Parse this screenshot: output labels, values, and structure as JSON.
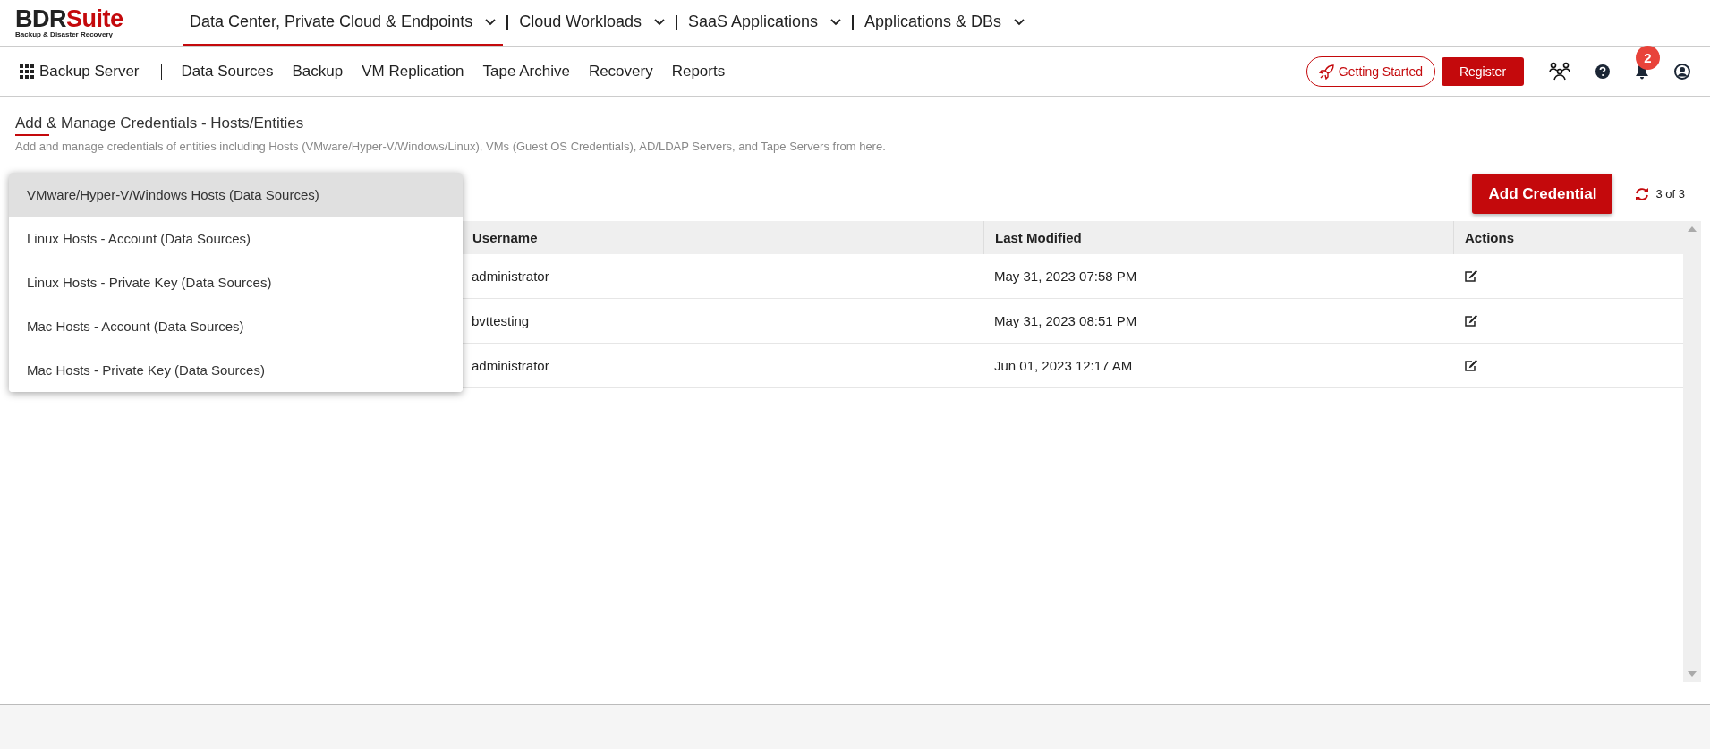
{
  "logo": {
    "brand": "BDR",
    "brand_accent": "Suite",
    "tagline": "Backup & Disaster Recovery"
  },
  "top_tabs": [
    {
      "label": "Data Center, Private Cloud & Endpoints",
      "selected": true
    },
    {
      "label": "Cloud Workloads",
      "selected": false
    },
    {
      "label": "SaaS Applications",
      "selected": false
    },
    {
      "label": "Applications & DBs",
      "selected": false
    }
  ],
  "module": {
    "label": "Backup Server"
  },
  "menu": [
    "Data Sources",
    "Backup",
    "VM Replication",
    "Tape Archive",
    "Recovery",
    "Reports"
  ],
  "getting_started": "Getting Started",
  "register": "Register",
  "notifications": {
    "count": "2"
  },
  "page": {
    "title": "Add & Manage Credentials - Hosts/Entities",
    "description": "Add and manage credentials of entities including Hosts (VMware/Hyper-V/Windows/Linux), VMs (Guest OS Credentials), AD/LDAP Servers, and Tape Servers from here."
  },
  "add_button": "Add Credential",
  "count": "3 of 3",
  "table": {
    "columns": [
      "Username",
      "Last Modified",
      "Actions"
    ],
    "rows": [
      {
        "username": "administrator",
        "last_modified": "May 31, 2023 07:58 PM"
      },
      {
        "username": "bvttesting",
        "last_modified": "May 31, 2023 08:51 PM"
      },
      {
        "username": "administrator",
        "last_modified": "Jun 01, 2023 12:17 AM"
      }
    ]
  },
  "dropdown": {
    "items": [
      {
        "label": "VMware/Hyper-V/Windows Hosts (Data Sources)",
        "selected": true
      },
      {
        "label": "Linux Hosts - Account (Data Sources)",
        "selected": false
      },
      {
        "label": "Linux Hosts - Private Key (Data Sources)",
        "selected": false
      },
      {
        "label": "Mac Hosts - Account (Data Sources)",
        "selected": false
      },
      {
        "label": "Mac Hosts - Private Key (Data Sources)",
        "selected": false
      }
    ]
  }
}
